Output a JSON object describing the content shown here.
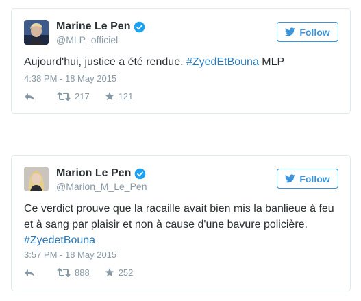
{
  "tweets": [
    {
      "display_name": "Marine Le Pen",
      "handle": "@MLP_officiel",
      "follow_label": "Follow",
      "text_before": "Aujourd'hui, justice a été rendue. ",
      "hashtag": "#ZyedEtBouna",
      "text_after": " MLP",
      "timestamp": "4:38 PM - 18 May 2015",
      "retweets": "217",
      "favorites": "121"
    },
    {
      "display_name": "Marion Le Pen",
      "handle": "@Marion_M_Le_Pen",
      "follow_label": "Follow",
      "text_line1": "Ce verdict prouve que la racaille avait bien mis la banlieue à feu",
      "text_line2": "et à sang par plaisir et non à cause d'une bavure policière.",
      "hashtag": "#ZyedetBouna",
      "timestamp": "3:57 PM - 18 May 2015",
      "retweets": "888",
      "favorites": "252"
    }
  ],
  "colors": {
    "link": "#2b7bb9",
    "follow": "#3b94d9",
    "muted": "#8899a6",
    "verified": "#1da1f2"
  }
}
